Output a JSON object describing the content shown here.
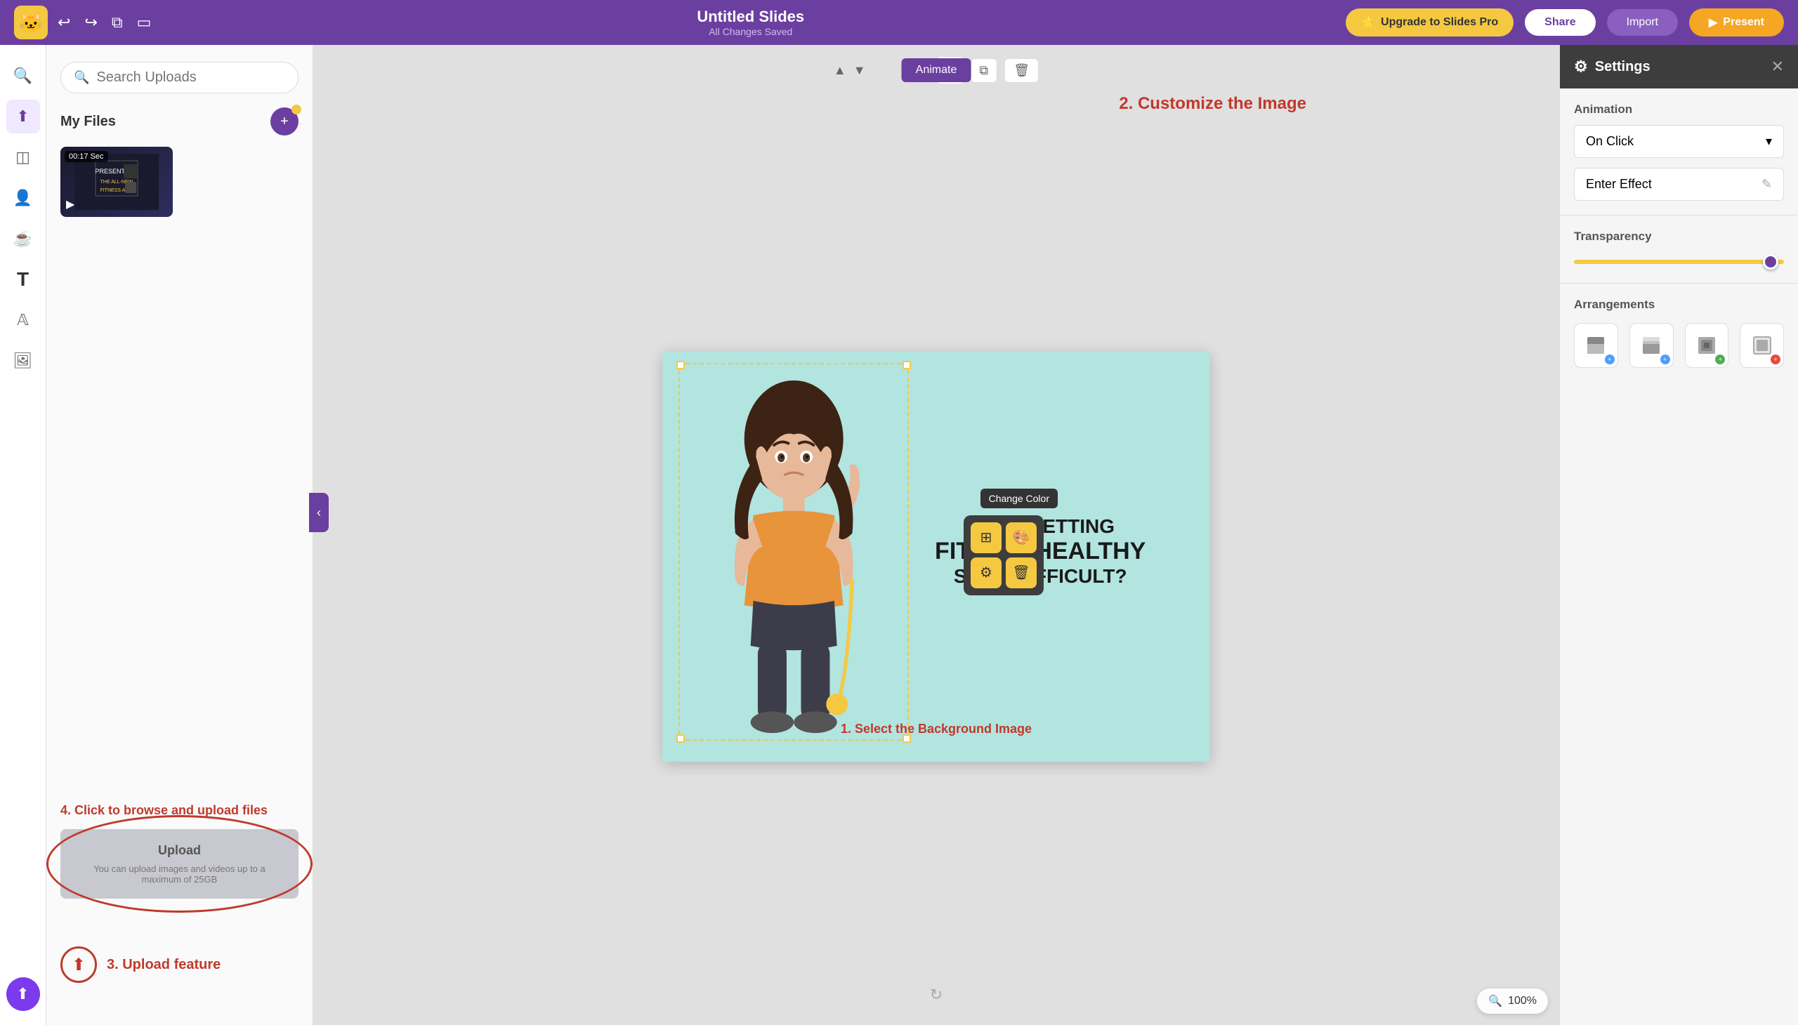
{
  "topbar": {
    "title": "Untitled Slides",
    "subtitle": "All Changes Saved",
    "upgrade_label": "Upgrade to Slides Pro",
    "share_label": "Share",
    "import_label": "Import",
    "present_label": "Present"
  },
  "upload_panel": {
    "search_placeholder": "Search Uploads",
    "my_files_label": "My Files",
    "video_duration": "00:17 Sec",
    "video_subtitle": "PRESENTING! THE ALL-NEW FITNESS APP!",
    "click_browse_label": "4. Click to browse and upload files",
    "upload_btn_label": "Upload",
    "upload_hint": "You can upload images and videos up to a maximum of 25GB",
    "upload_feature_label": "3. Upload feature"
  },
  "slide": {
    "top_annotation": "2. Customize the Image",
    "line1": "DOES GETTING",
    "line2": "FIT AND HEALTHY",
    "line3": "SEEM DIFFICULT?",
    "bottom_text": "1. Select the Background Image"
  },
  "toolbar": {
    "animate_label": "Animate",
    "add_label": "+",
    "copy_label": "⧉",
    "delete_label": "🗑"
  },
  "context_menu": {
    "change_color_tooltip": "Change Color",
    "btn1": "⊞",
    "btn2": "🎨",
    "btn3": "⚙",
    "btn4": "🗑"
  },
  "settings": {
    "title": "Settings",
    "close_label": "✕",
    "animation_label": "Animation",
    "on_click_label": "On Click",
    "enter_effect_label": "Enter Effect",
    "transparency_label": "Transparency",
    "transparency_value": 85,
    "arrangements_label": "Arrangements"
  },
  "zoom": {
    "level": "100%"
  }
}
